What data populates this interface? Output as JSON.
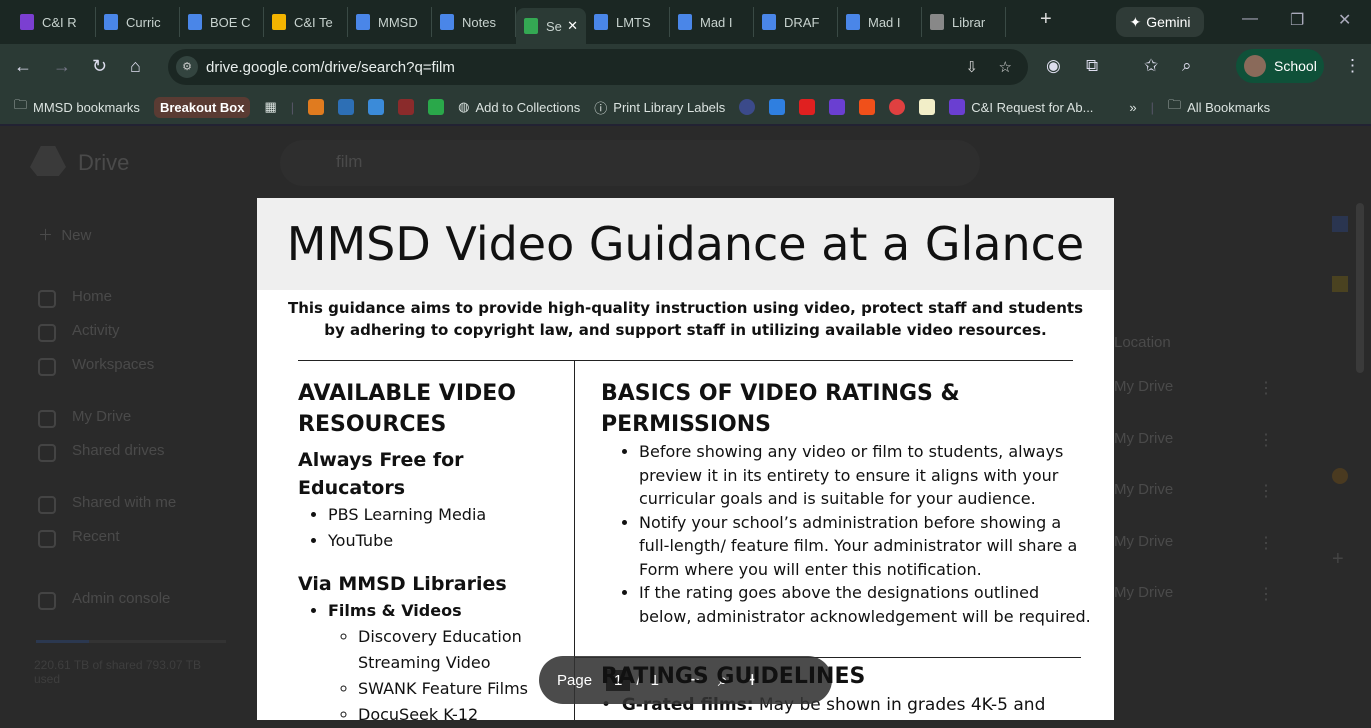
{
  "browser": {
    "tabs": [
      {
        "label": "C&I R",
        "color": "#7b3fd1"
      },
      {
        "label": "Curric",
        "color": "#4a86e8"
      },
      {
        "label": "BOE C",
        "color": "#4a86e8"
      },
      {
        "label": "C&I Te",
        "color": "#f4b400"
      },
      {
        "label": "MMSD",
        "color": "#4a86e8"
      },
      {
        "label": "Notes",
        "color": "#4a86e8"
      },
      {
        "label": "Se",
        "color": "#34a853",
        "active": true
      },
      {
        "label": "LMTS",
        "color": "#4a86e8"
      },
      {
        "label": "Mad I",
        "color": "#4a86e8"
      },
      {
        "label": "DRAF",
        "color": "#4a86e8"
      },
      {
        "label": "Mad I",
        "color": "#4a86e8"
      },
      {
        "label": "Librar",
        "color": "#888"
      }
    ],
    "gemini": "Gemini",
    "url": "drive.google.com/drive/search?q=film",
    "profile": "School",
    "bookmarks": {
      "folder": "MMSD bookmarks",
      "chip": "Breakout Box",
      "add": "Add to Collections",
      "print": "Print Library Labels",
      "request": "C&I Request for Ab...",
      "all": "All Bookmarks"
    }
  },
  "drive": {
    "logo": "Drive",
    "search": "film",
    "new": "New",
    "nav": [
      "Home",
      "Activity",
      "Workspaces",
      "My Drive",
      "Shared drives",
      "Shared with me",
      "Recent",
      "Admin console"
    ],
    "storage": "220.61 TB of shared 793.07 TB used",
    "storage_fraction": 0.28,
    "location_header": "Location",
    "locations": [
      "My Drive",
      "My Drive",
      "My Drive",
      "My Drive",
      "My Drive"
    ]
  },
  "doc": {
    "title": "MMSD Video Guidance at a Glance",
    "intro": "This guidance aims to provide high-quality instruction using video, protect staff and students by adhering to copyright law, and support staff in utilizing available video resources.",
    "left_heading": "AVAILABLE VIDEO RESOURCES",
    "free_heading": "Always Free for Educators",
    "free_items": [
      "PBS Learning Media",
      "YouTube"
    ],
    "libraries_heading": "Via MMSD Libraries",
    "films_label": "Films & Videos",
    "films_items": [
      "Discovery Education Streaming Video",
      "SWANK Feature Films",
      "DocuSeek K-12"
    ],
    "right_heading": "BASICS OF VIDEO RATINGS & PERMISSIONS",
    "basics": [
      "Before showing any video or film to students, always preview it in its entirety to ensure it aligns with your curricular goals and is suitable for your audience.",
      "Notify your school’s administration before showing a full-length/ feature film. Your administrator will share a Form where you will enter this notification.",
      "If the rating goes above the designations outlined below, administrator acknowledgement will be required."
    ],
    "ratings_heading": "RATINGS GUIDELINES",
    "g_label": "G-rated films:",
    "g_text": " May be shown in grades 4K-5 and"
  },
  "pager": {
    "label": "Page",
    "current": "1",
    "sep": "/",
    "total": "1"
  }
}
